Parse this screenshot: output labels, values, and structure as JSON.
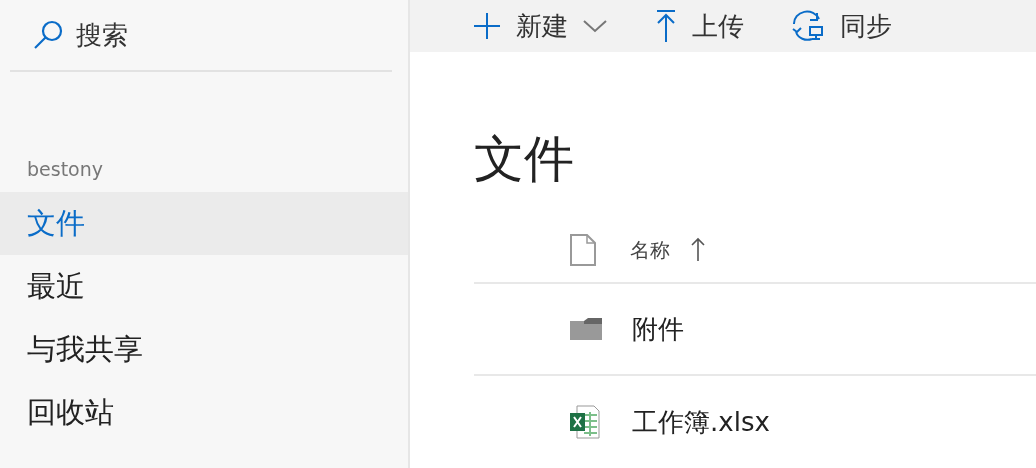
{
  "search": {
    "label": "搜索"
  },
  "toolbar": [
    {
      "kind": "new",
      "label": "新建",
      "dropdown": true
    },
    {
      "kind": "upload",
      "label": "上传",
      "dropdown": false
    },
    {
      "kind": "sync",
      "label": "同步",
      "dropdown": false
    }
  ],
  "sidebar": {
    "account": "bestony",
    "items": [
      {
        "label": "文件",
        "selected": true
      },
      {
        "label": "最近",
        "selected": false
      },
      {
        "label": "与我共享",
        "selected": false
      },
      {
        "label": "回收站",
        "selected": false
      }
    ]
  },
  "page_title": "文件",
  "table": {
    "columns": [
      {
        "label": "名称",
        "sort_ascending": true
      }
    ],
    "rows": [
      {
        "kind": "folder",
        "name": "附件"
      },
      {
        "kind": "excel",
        "name": "工作簿.xlsx"
      }
    ]
  }
}
